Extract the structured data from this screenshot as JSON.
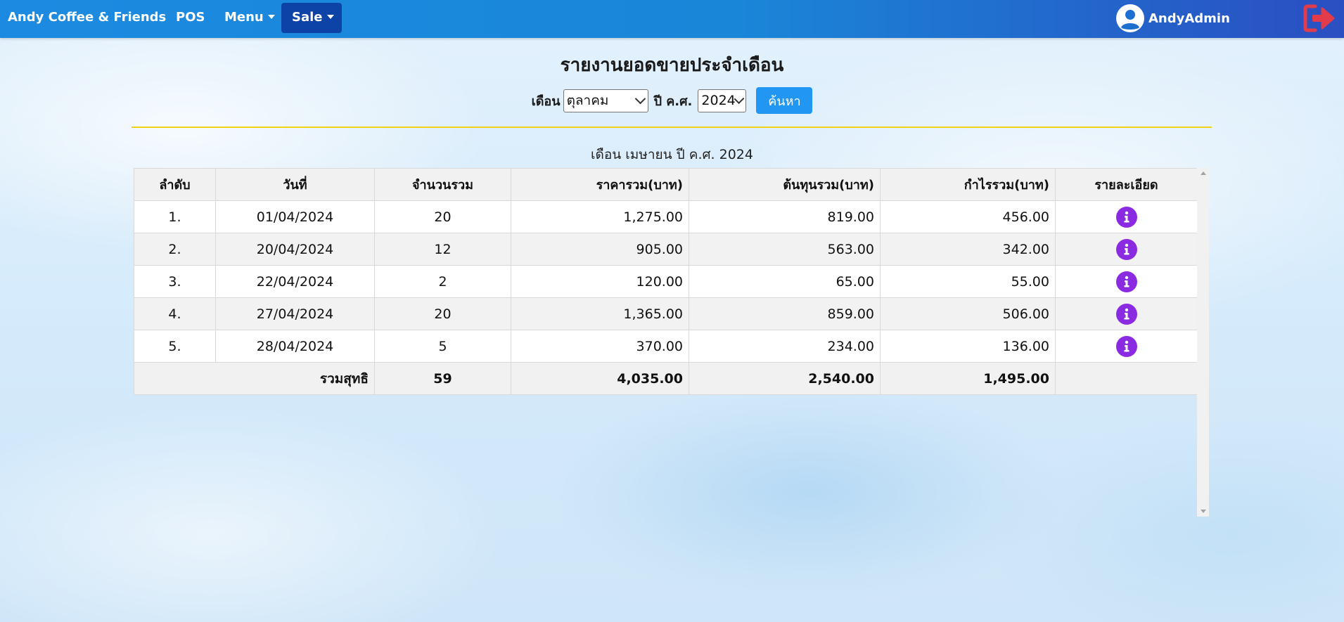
{
  "navbar": {
    "brand": "Andy Coffee & Friends",
    "pos": "POS",
    "menu": "Menu",
    "sale": "Sale",
    "username": "AndyAdmin",
    "colors": {
      "bar_start": "#1b8ae0",
      "bar_end": "#2a4fc2",
      "active_item": "#0d43a6",
      "logout_icon": "#e23b4a"
    },
    "icons": {
      "avatar": "user-circle-icon",
      "logout": "sign-out-icon"
    }
  },
  "page": {
    "title": "รายงานยอดขายประจำเดือน",
    "filter": {
      "month_label": "เดือน",
      "month_value": "ตุลาคม",
      "year_label": "ปี ค.ศ.",
      "year_value": "2024",
      "search_button": "ค้นหา"
    },
    "subtitle": "เดือน เมษายน ปี ค.ศ. 2024"
  },
  "table": {
    "headers": [
      "ลำดับ",
      "วันที่",
      "จำนวนรวม",
      "ราคารวม(บาท)",
      "ต้นทุนรวม(บาท)",
      "กำไรรวม(บาท)",
      "รายละเอียด"
    ],
    "rows": [
      {
        "no": "1.",
        "date": "01/04/2024",
        "qty": "20",
        "price": "1,275.00",
        "cost": "819.00",
        "profit": "456.00"
      },
      {
        "no": "2.",
        "date": "20/04/2024",
        "qty": "12",
        "price": "905.00",
        "cost": "563.00",
        "profit": "342.00"
      },
      {
        "no": "3.",
        "date": "22/04/2024",
        "qty": "2",
        "price": "120.00",
        "cost": "65.00",
        "profit": "55.00"
      },
      {
        "no": "4.",
        "date": "27/04/2024",
        "qty": "20",
        "price": "1,365.00",
        "cost": "859.00",
        "profit": "506.00"
      },
      {
        "no": "5.",
        "date": "28/04/2024",
        "qty": "5",
        "price": "370.00",
        "cost": "234.00",
        "profit": "136.00"
      }
    ],
    "total": {
      "label": "รวมสุทธิ",
      "qty": "59",
      "price": "4,035.00",
      "cost": "2,540.00",
      "profit": "1,495.00"
    },
    "detail_icon": "info-circle-icon",
    "colors": {
      "detail_icon": "#8a2be2",
      "divider": "#f0d21a",
      "search_button": "#2196f3"
    }
  }
}
